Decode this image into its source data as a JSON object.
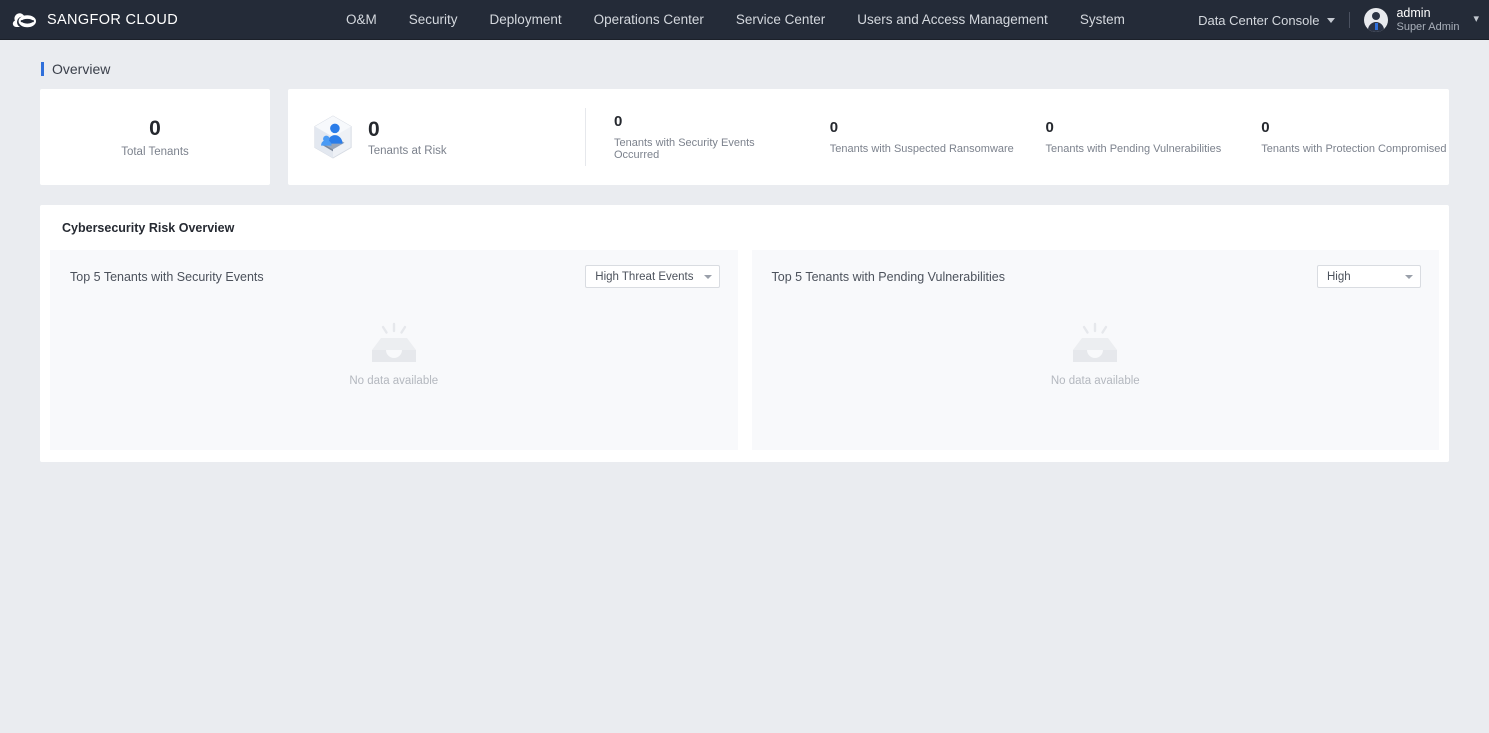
{
  "topbar": {
    "brand": "SANGFOR CLOUD",
    "logo_icon": "cloud-logo-icon",
    "nav": [
      {
        "label": "O&M"
      },
      {
        "label": "Security"
      },
      {
        "label": "Deployment"
      },
      {
        "label": "Operations Center"
      },
      {
        "label": "Service Center"
      },
      {
        "label": "Users and Access Management"
      },
      {
        "label": "System"
      }
    ],
    "console_switcher": {
      "label": "Data Center Console",
      "icon": "chevron-down-icon"
    },
    "user": {
      "name": "admin",
      "role": "Super Admin",
      "avatar_icon": "user-avatar-icon",
      "chevron_icon": "chevron-down-icon"
    }
  },
  "page": {
    "title": "Overview"
  },
  "kpis": {
    "total_tenants": {
      "value": "0",
      "label": "Total Tenants"
    },
    "tenants_at_risk": {
      "value": "0",
      "label": "Tenants at Risk",
      "icon": "tenant-risk-hex-icon"
    },
    "sub": [
      {
        "value": "0",
        "label": "Tenants with Security Events Occurred"
      },
      {
        "value": "0",
        "label": "Tenants with Suspected Ransomware"
      },
      {
        "value": "0",
        "label": "Tenants with Pending Vulnerabilities"
      },
      {
        "value": "0",
        "label": "Tenants with Protection Compromised"
      }
    ]
  },
  "cyber": {
    "title": "Cybersecurity Risk Overview",
    "panels": [
      {
        "title": "Top 5 Tenants with Security Events",
        "filter_value": "High Threat Events",
        "empty_text": "No data available",
        "empty_icon": "empty-inbox-icon"
      },
      {
        "title": "Top 5 Tenants with Pending Vulnerabilities",
        "filter_value": "High",
        "empty_text": "No data available",
        "empty_icon": "empty-inbox-icon"
      }
    ]
  },
  "colors": {
    "topbar_bg": "#242b38",
    "page_bg": "#eaecf0",
    "accent": "#2f6fdb",
    "panel_bg": "#f8f9fb"
  }
}
